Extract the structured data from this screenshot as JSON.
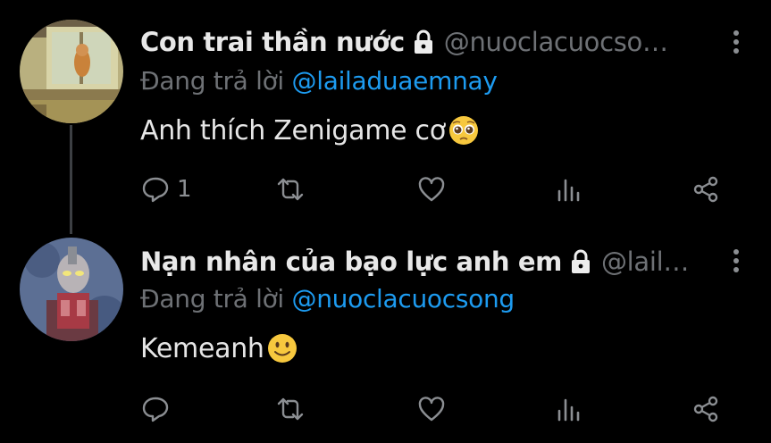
{
  "tweets": [
    {
      "display_name": "Con trai thần nước",
      "handle": "@nuoclacuocso…",
      "reply_prefix": "Đang trả lời",
      "reply_to": "@lailaduaemnay",
      "text": "Anh thích Zenigame cơ",
      "reply_count": "1",
      "emoji": "pleading-face-emoji"
    },
    {
      "display_name": "Nạn nhân của bạo lực anh em",
      "handle": "@lail…",
      "reply_prefix": "Đang trả lời",
      "reply_to": "@nuoclacuocsong",
      "text": "Kemeanh",
      "reply_count": "",
      "emoji": "slightly-smiling-face-emoji"
    }
  ],
  "colors": {
    "background": "#000000",
    "link": "#1d9bf0",
    "muted": "#6e7175",
    "icon": "#8b8e92"
  },
  "icons": [
    "lock-icon",
    "more-vertical-icon",
    "reply-icon",
    "retweet-icon",
    "like-icon",
    "analytics-icon",
    "share-icon"
  ]
}
